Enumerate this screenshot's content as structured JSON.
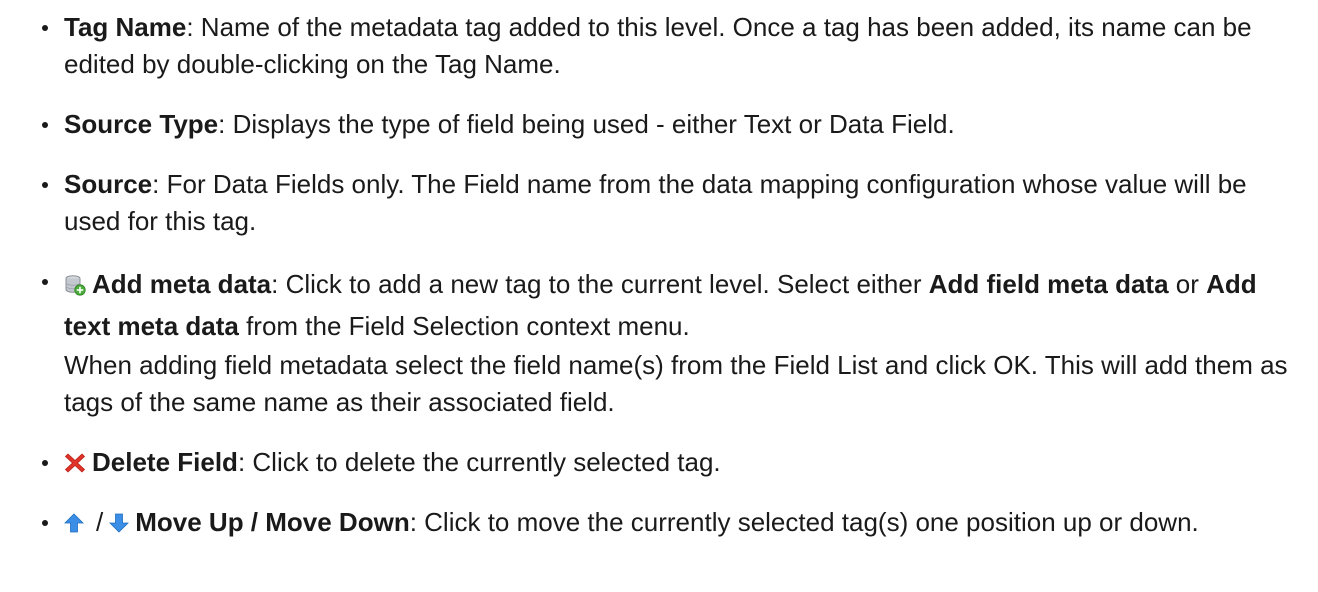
{
  "items": [
    {
      "term": "Tag Name",
      "text": ": Name of the metadata tag added to this level. Once a tag has been added, its name can be edited by double-clicking on the Tag Name."
    },
    {
      "term": "Source Type",
      "text": ": Displays the type of field being used - either Text or Data Field."
    },
    {
      "term": "Source",
      "text": ": For Data Fields only. The Field name from the data mapping configuration whose value will be used for this tag."
    },
    {
      "icon": "database-add-icon",
      "term": "Add meta data",
      "text1": ": Click to add a new tag to the current level. Select either ",
      "bold1": "Add field meta data",
      "text2": " or ",
      "bold2": "Add text meta data",
      "text3": " from the Field Selection context menu.",
      "para2": "When adding field metadata select the field name(s) from the Field List and click OK. This will add them as tags of the same name as their associated field."
    },
    {
      "icon": "red-x-icon",
      "term": "Delete Field",
      "text": ": Click to delete the currently selected tag."
    },
    {
      "icons": [
        "arrow-up-icon",
        "arrow-down-icon"
      ],
      "separator": "/",
      "term": "Move Up / Move Down",
      "text": ": Click to move the currently selected tag(s) one position up or down."
    }
  ],
  "colors": {
    "text": "#1a1a1a",
    "delete_icon": "#e0342a",
    "arrow_icon": "#3a8ee6"
  }
}
